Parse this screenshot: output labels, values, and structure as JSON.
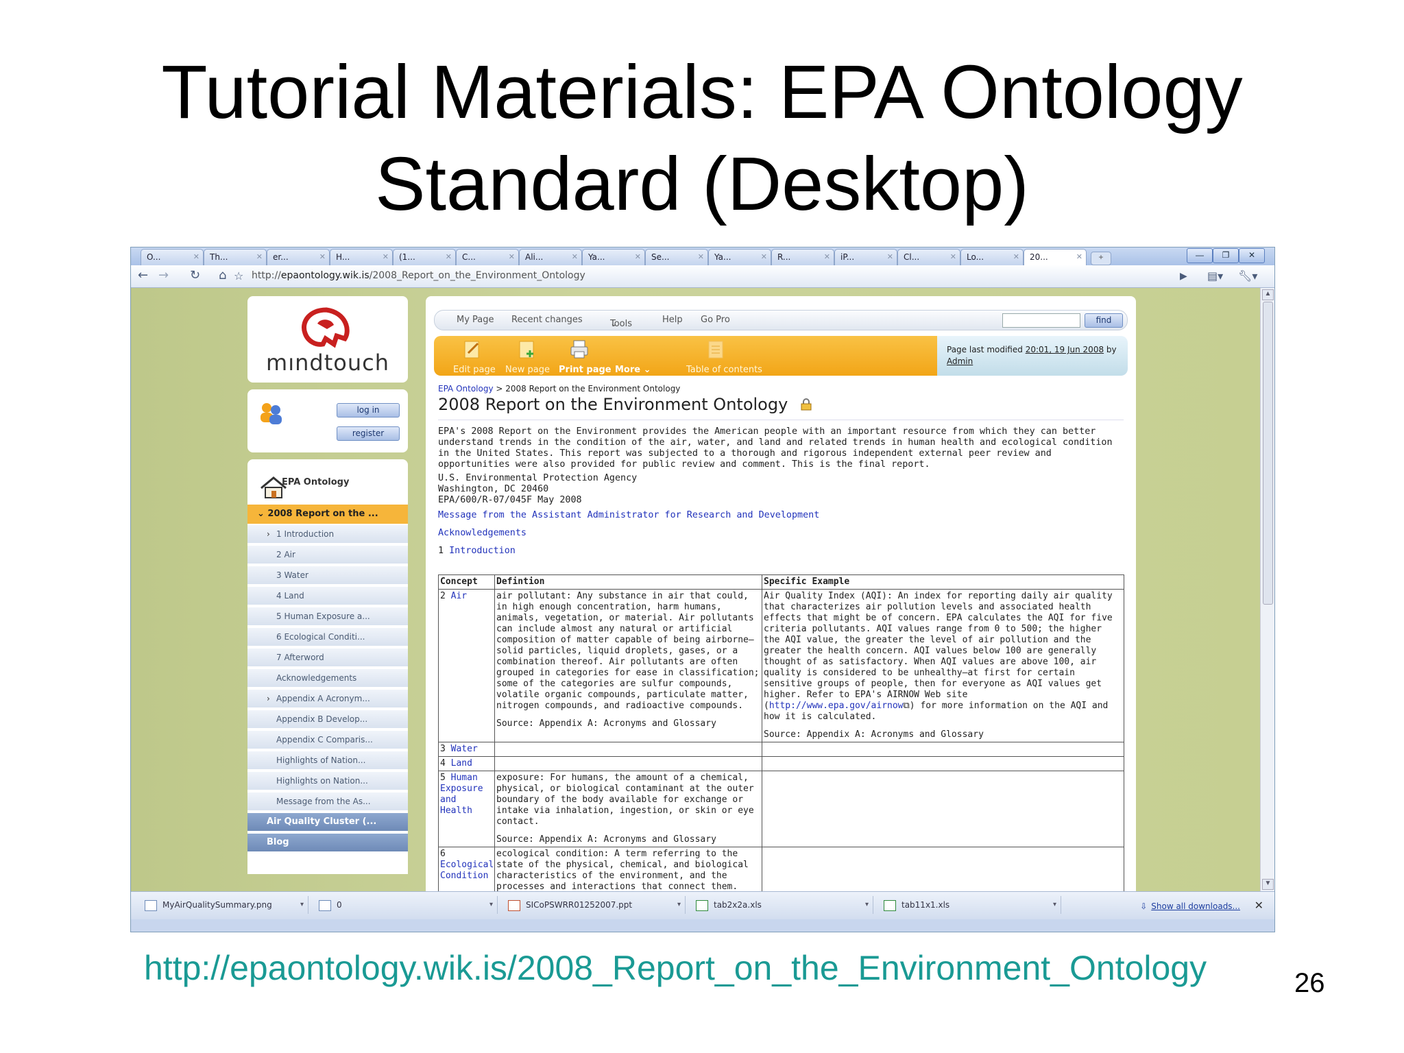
{
  "slide": {
    "title_line1": "Tutorial Materials: EPA Ontology",
    "title_line2": "Standard (Desktop)",
    "url": "http://epaontology.wik.is/2008_Report_on_the_Environment_Ontology",
    "page_number": "26"
  },
  "browser": {
    "tabs": [
      "O...",
      "Th...",
      "er...",
      "H...",
      "(1...",
      "C...",
      "Ali...",
      "Ya...",
      "Se...",
      "Ya...",
      "R...",
      "iP...",
      "Cl...",
      "Lo...",
      "20..."
    ],
    "active_tab_index": 14,
    "url_prefix": "http://",
    "url_host": "epaontology.wik.is",
    "url_path": "/2008_Report_on_the_Environment_Ontology",
    "window_buttons": [
      "—",
      "❐",
      "✕"
    ]
  },
  "sidebar": {
    "logo_text": "mındtouch",
    "login_label": "log in",
    "register_label": "register",
    "home_label": "EPA Ontology",
    "current_item": "2008 Report on the ...",
    "items": [
      {
        "label": "1 Introduction",
        "expandable": true
      },
      {
        "label": "2 Air",
        "expandable": false
      },
      {
        "label": "3 Water",
        "expandable": false
      },
      {
        "label": "4 Land",
        "expandable": false
      },
      {
        "label": "5 Human Exposure a...",
        "expandable": false
      },
      {
        "label": "6 Ecological Conditi...",
        "expandable": false
      },
      {
        "label": "7 Afterword",
        "expandable": false
      },
      {
        "label": "Acknowledgements",
        "expandable": false
      },
      {
        "label": "Appendix A Acronym...",
        "expandable": true
      },
      {
        "label": "Appendix B Develop...",
        "expandable": false
      },
      {
        "label": "Appendix C Comparis...",
        "expandable": false
      },
      {
        "label": "Highlights of Nation...",
        "expandable": false
      },
      {
        "label": "Highlights on Nation...",
        "expandable": false
      },
      {
        "label": "Message from the As...",
        "expandable": false
      }
    ],
    "sections": [
      "Air Quality Cluster (...",
      "Blog"
    ]
  },
  "topnav": {
    "items": [
      "My Page",
      "Recent changes",
      "Tools",
      "Help",
      "Go Pro"
    ],
    "find_label": "find",
    "find_value": ""
  },
  "actions": {
    "edit": "Edit page",
    "new": "New page",
    "print": "Print page",
    "more": "More",
    "toc": "Table of contents"
  },
  "modified": {
    "prefix": "Page last modified ",
    "time": "20:01, 19 Jun 2008",
    "by": " by ",
    "user": "Admin"
  },
  "breadcrumb": {
    "root": "EPA Ontology",
    "separator": " > ",
    "current": "2008 Report on the Environment Ontology"
  },
  "page": {
    "title": "2008 Report on the Environment Ontology",
    "intro": "EPA's 2008 Report on the Environment provides the American people with an important resource from which they can better understand trends in the condition of the air, water, and land and related trends in human health and ecological condition in the United States. This report was subjected to a thorough and rigorous independent external peer review and opportunities were also provided for public review and comment. This is the final report.",
    "address_line1": "U.S. Environmental Protection Agency",
    "address_line2": "Washington, DC 20460",
    "address_line3": "EPA/600/R-07/045F May 2008",
    "links": [
      "Message from the Assistant Administrator for Research and Development",
      "Acknowledgements"
    ],
    "intro_num": "1 ",
    "intro_link": "Introduction"
  },
  "table": {
    "headers": [
      "Concept",
      "Defintion",
      "Specific Example"
    ],
    "rows": [
      {
        "num": "2 ",
        "concept": "Air",
        "definition": "air pollutant: Any substance in air that could, in high enough concentration, harm humans, animals, vegetation, or material. Air pollutants can include almost any natural or artificial composition of matter capable of being airborne—solid particles, liquid droplets, gases, or a combination thereof. Air pollutants are often grouped in categories for ease in classification; some of the categories are sulfur compounds, volatile organic compounds, particulate matter, nitrogen compounds, and radioactive compounds.",
        "definition_source": "Source: Appendix A: Acronyms and Glossary",
        "example": "Air Quality Index (AQI): An index for reporting daily air quality that characterizes air pollution levels and associated health effects that might be of concern. EPA calculates the AQI for five criteria pollutants. AQI values range from 0 to 500; the higher the AQI value, the greater the level of air pollution and the greater the health concern. AQI values below 100 are generally thought of as satisfactory. When AQI values are above 100, air quality is considered to be unhealthy—at first for certain sensitive groups of people, then for everyone as AQI values get higher. Refer to EPA's AIRNOW Web site (",
        "example_link": "http://www.epa.gov/airnow",
        "example_end": ") for more information on the AQI and how it is calculated.",
        "example_source": "Source: Appendix A: Acronyms and Glossary"
      },
      {
        "num": "3 ",
        "concept": "Water"
      },
      {
        "num": "4 ",
        "concept": "Land"
      },
      {
        "num": "5 ",
        "concept": "Human Exposure and Health",
        "definition": "exposure: For humans, the amount of a chemical, physical, or biological contaminant at the outer boundary of the body available for exchange or intake via inhalation, ingestion, or skin or eye contact.",
        "definition_source": "Source: Appendix A: Acronyms and Glossary"
      },
      {
        "num": "6 ",
        "concept": "Ecological Condition",
        "definition": "ecological condition: A term referring to the state of the physical, chemical, and biological characteristics of the environment, and the processes and interactions that connect them."
      }
    ]
  },
  "downloads": {
    "files": [
      "MyAirQualitySummary.png",
      "0",
      "SICoPSWRR01252007.ppt",
      "tab2x2a.xls",
      "tab11x1.xls"
    ],
    "show_all": "Show all downloads..."
  },
  "colors": {
    "url_teal": "#1a9a94",
    "action_orange": "#f2a517",
    "nav_current": "#f6b53a",
    "link_blue": "#2233bb",
    "page_bg_olive": "#c6cf92"
  }
}
